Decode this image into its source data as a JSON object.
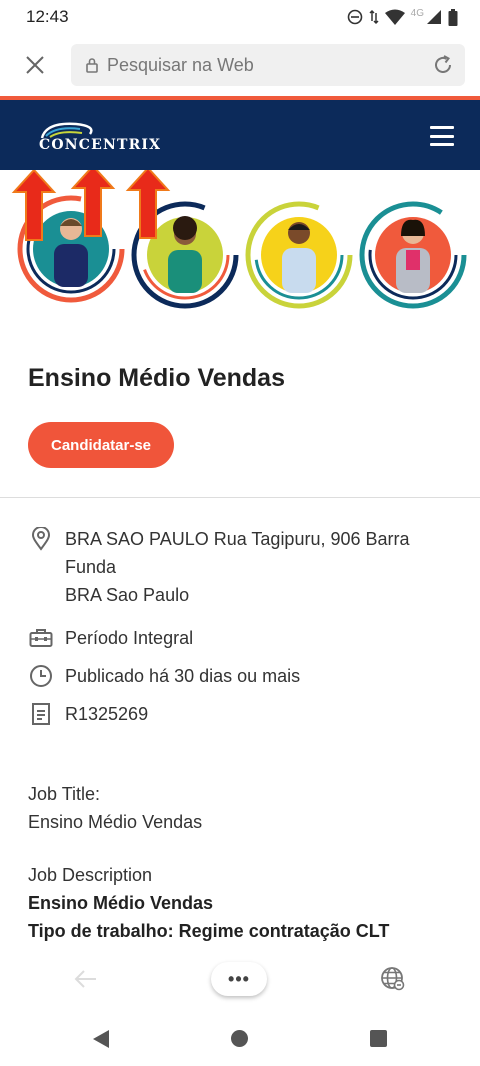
{
  "status_bar": {
    "time": "12:43",
    "network": "4G"
  },
  "browser": {
    "url_placeholder": "Pesquisar na Web"
  },
  "site": {
    "logo_text": "CONCENTRIX",
    "brand_color": "#0c2a5a",
    "accent_color": "#f0553a"
  },
  "job": {
    "title": "Ensino Médio Vendas",
    "apply_label": "Candidatar-se",
    "location_line1": "BRA SAO PAULO Rua Tagipuru, 906 Barra",
    "location_line2": "Funda",
    "location_line3": "BRA Sao Paulo",
    "schedule": "Período Integral",
    "posted": "Publicado há 30 dias ou mais",
    "req_id": "R1325269",
    "job_title_label": "Job Title:",
    "job_title_value": "Ensino Médio Vendas",
    "job_desc_label": "Job Description",
    "job_desc_title": "Ensino Médio Vendas",
    "job_type": "Tipo de trabalho: Regime contratação CLT"
  },
  "toolbar": {
    "more_label": "•••"
  },
  "icons": [
    "close-icon",
    "lock-icon",
    "reload-icon",
    "menu-icon",
    "location-icon",
    "briefcase-icon",
    "clock-icon",
    "document-icon",
    "back-arrow-icon",
    "globe-icon"
  ]
}
